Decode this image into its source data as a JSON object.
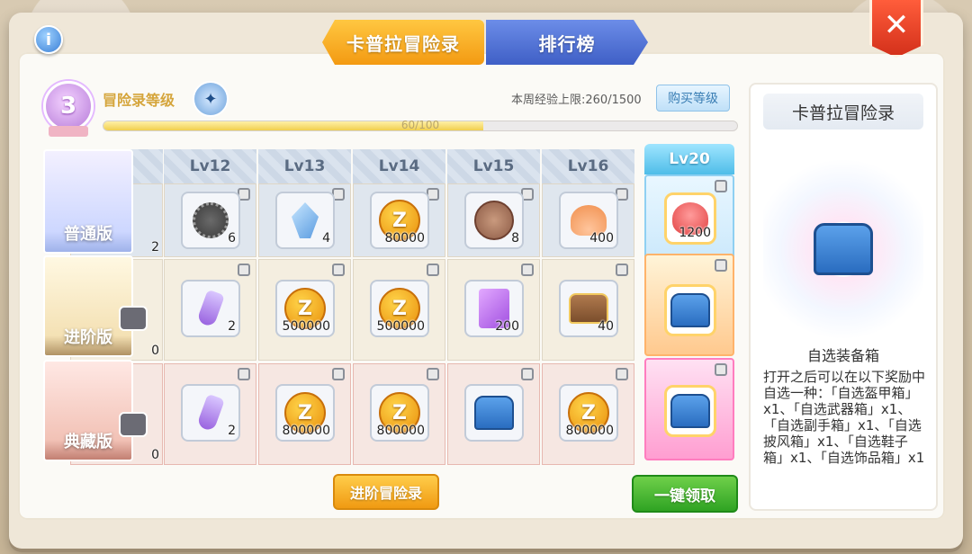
{
  "header": {
    "tabs": [
      {
        "label": "卡普拉冒险录",
        "active": true
      },
      {
        "label": "排行榜",
        "active": false
      }
    ],
    "info_icon": "i",
    "close_icon": "✕"
  },
  "level": {
    "badge_value": "3",
    "title": "冒险录等级",
    "weekly_cap_text": "本周经验上限:260/1500",
    "buy_button": "购买等级",
    "progress_text": "60/100",
    "progress_fraction": 0.6
  },
  "columns": [
    "Lv12",
    "Lv13",
    "Lv14",
    "Lv15",
    "Lv16"
  ],
  "rows": {
    "normal": [
      {
        "icon": "disc",
        "qty": "6"
      },
      {
        "icon": "crystal",
        "qty": "4"
      },
      {
        "icon": "zeny-coin",
        "qty": "80000"
      },
      {
        "icon": "cat-coin",
        "qty": "8"
      },
      {
        "icon": "shell",
        "qty": "400"
      }
    ],
    "advanced": [
      {
        "icon": "potion",
        "qty": "2"
      },
      {
        "icon": "zeny-coin",
        "qty": "500000"
      },
      {
        "icon": "zeny-coin",
        "qty": "500000"
      },
      {
        "icon": "card",
        "qty": "200"
      },
      {
        "icon": "chest-brown",
        "qty": "40"
      }
    ],
    "collector": [
      {
        "icon": "potion",
        "qty": "2"
      },
      {
        "icon": "zeny-coin",
        "qty": "800000"
      },
      {
        "icon": "zeny-coin",
        "qty": "800000"
      },
      {
        "icon": "chest-blue",
        "qty": ""
      },
      {
        "icon": "zeny-coin",
        "qty": "800000"
      }
    ]
  },
  "partial_column_qty": {
    "normal": "2",
    "advanced": "0",
    "collector": "0"
  },
  "tiers": {
    "normal": "普通版",
    "advanced": "进阶版",
    "collector": "典藏版"
  },
  "highlight_column": {
    "label": "Lv20",
    "rows": [
      {
        "icon": "slime",
        "qty": "1200"
      },
      {
        "icon": "chest-blue",
        "qty": ""
      },
      {
        "icon": "chest-blue",
        "qty": ""
      }
    ]
  },
  "side_panel": {
    "title": "卡普拉冒险录",
    "item_name": "自选装备箱",
    "description": "打开之后可以在以下奖励中自选一种：「自选盔甲箱」x1、「自选武器箱」x1、「自选副手箱」x1、「自选披风箱」x1、「自选鞋子箱」x1、「自选饰品箱」x1"
  },
  "buttons": {
    "advanced_adventure": "进阶冒险录",
    "claim_all": "一键领取"
  },
  "colors": {
    "tab_active": "#f39a12",
    "tab_inactive": "#3f5fc6",
    "close": "#d4311b",
    "claim": "#2fa323"
  }
}
